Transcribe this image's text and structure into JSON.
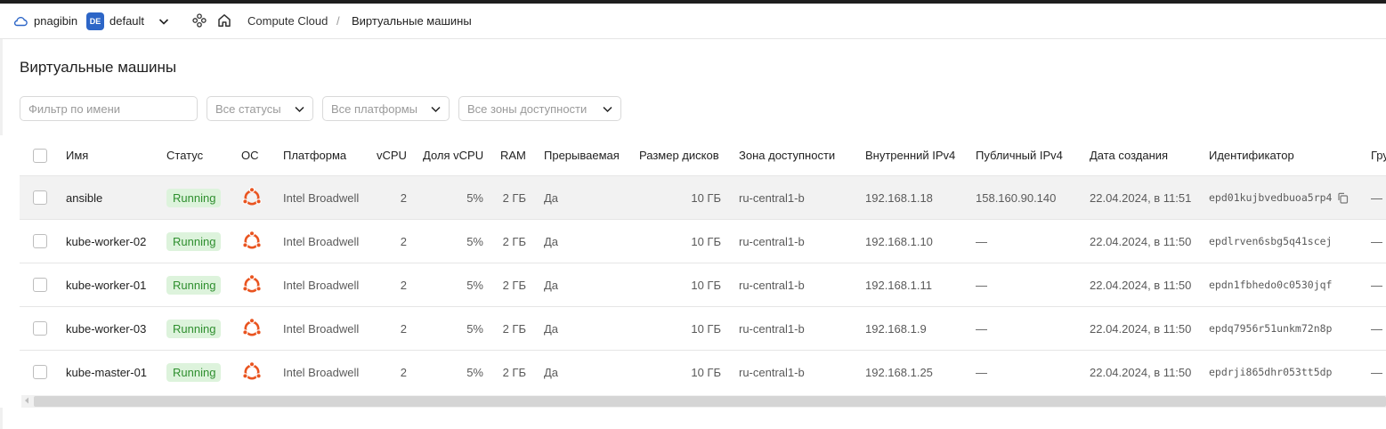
{
  "header": {
    "user": "pnagibin",
    "folder_badge": "DE",
    "folder": "default",
    "breadcrumb_service": "Compute Cloud",
    "breadcrumb_separator": "/",
    "breadcrumb_page": "Виртуальные машины"
  },
  "page": {
    "title": "Виртуальные машины"
  },
  "filters": {
    "name_placeholder": "Фильтр по имени",
    "status": "Все статусы",
    "platform": "Все платформы",
    "zone": "Все зоны доступности"
  },
  "table": {
    "columns": {
      "name": "Имя",
      "status": "Статус",
      "os": "ОС",
      "platform": "Платформа",
      "vcpu": "vCPU",
      "cpu_share": "Доля vCPU",
      "ram": "RAM",
      "preemptible": "Прерываемая",
      "disk": "Размер дисков",
      "zone": "Зона доступности",
      "internal_ip": "Внутренний IPv4",
      "public_ip": "Публичный IPv4",
      "created": "Дата создания",
      "id": "Идентификатор",
      "group": "Гру"
    },
    "rows": [
      {
        "name": "ansible",
        "status": "Running",
        "os_icon": "ubuntu-icon",
        "platform": "Intel Broadwell",
        "vcpu": "2",
        "cpu_share": "5%",
        "ram": "2 ГБ",
        "preemptible": "Да",
        "disk": "10 ГБ",
        "zone": "ru-central1-b",
        "internal_ip": "192.168.1.18",
        "public_ip": "158.160.90.140",
        "created": "22.04.2024, в 11:51",
        "id": "epd01kujbvedbuoa5rp4",
        "group": "—"
      },
      {
        "name": "kube-worker-02",
        "status": "Running",
        "os_icon": "ubuntu-icon",
        "platform": "Intel Broadwell",
        "vcpu": "2",
        "cpu_share": "5%",
        "ram": "2 ГБ",
        "preemptible": "Да",
        "disk": "10 ГБ",
        "zone": "ru-central1-b",
        "internal_ip": "192.168.1.10",
        "public_ip": "—",
        "created": "22.04.2024, в 11:50",
        "id": "epdlrven6sbg5q41scej",
        "group": "—"
      },
      {
        "name": "kube-worker-01",
        "status": "Running",
        "os_icon": "ubuntu-icon",
        "platform": "Intel Broadwell",
        "vcpu": "2",
        "cpu_share": "5%",
        "ram": "2 ГБ",
        "preemptible": "Да",
        "disk": "10 ГБ",
        "zone": "ru-central1-b",
        "internal_ip": "192.168.1.11",
        "public_ip": "—",
        "created": "22.04.2024, в 11:50",
        "id": "epdn1fbhedo0c0530jqf",
        "group": "—"
      },
      {
        "name": "kube-worker-03",
        "status": "Running",
        "os_icon": "ubuntu-icon",
        "platform": "Intel Broadwell",
        "vcpu": "2",
        "cpu_share": "5%",
        "ram": "2 ГБ",
        "preemptible": "Да",
        "disk": "10 ГБ",
        "zone": "ru-central1-b",
        "internal_ip": "192.168.1.9",
        "public_ip": "—",
        "created": "22.04.2024, в 11:50",
        "id": "epdq7956r51unkm72n8p",
        "group": "—"
      },
      {
        "name": "kube-master-01",
        "status": "Running",
        "os_icon": "ubuntu-icon",
        "platform": "Intel Broadwell",
        "vcpu": "2",
        "cpu_share": "5%",
        "ram": "2 ГБ",
        "preemptible": "Да",
        "disk": "10 ГБ",
        "zone": "ru-central1-b",
        "internal_ip": "192.168.1.25",
        "public_ip": "—",
        "created": "22.04.2024, в 11:50",
        "id": "epdrji865dhr053tt5dp",
        "group": "—"
      }
    ]
  },
  "colors": {
    "accent": "#2d66c7",
    "status_running_bg": "#ddf3dc",
    "status_running_text": "#2f8f2f",
    "ubuntu_orange": "#e95420",
    "selected_row": "#f2f2f2"
  }
}
